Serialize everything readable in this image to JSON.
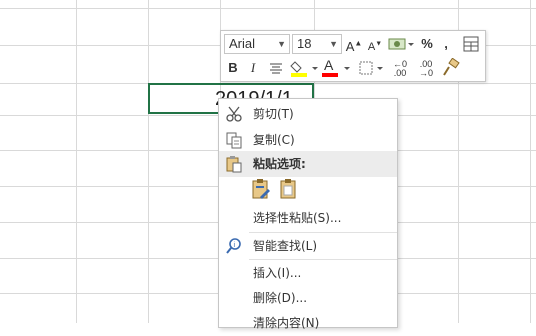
{
  "cell": {
    "value": "2019/1/1"
  },
  "toolbar": {
    "font_name": "Arial",
    "font_size": "18",
    "percent_label": "%",
    "comma_label": ",",
    "bold_label": "B",
    "italic_label": "I",
    "font_color_label": "A",
    "highlight_color": "#ffff00",
    "font_color": "#ff0000"
  },
  "context_menu": {
    "items": [
      {
        "label": "剪切(T)",
        "icon": "scissors-icon"
      },
      {
        "label": "复制(C)",
        "icon": "copy-icon"
      },
      {
        "label": "粘贴选项:",
        "icon": "paste-icon"
      },
      {
        "label": "选择性粘贴(S)...",
        "icon": ""
      },
      {
        "label": "智能查找(L)",
        "icon": "smart-lookup-icon"
      },
      {
        "label": "插入(I)...",
        "icon": ""
      },
      {
        "label": "删除(D)...",
        "icon": ""
      },
      {
        "label": "清除内容(N)",
        "icon": ""
      }
    ]
  },
  "colors": {
    "accent": "#217346",
    "grid": "#d9d9d9"
  }
}
